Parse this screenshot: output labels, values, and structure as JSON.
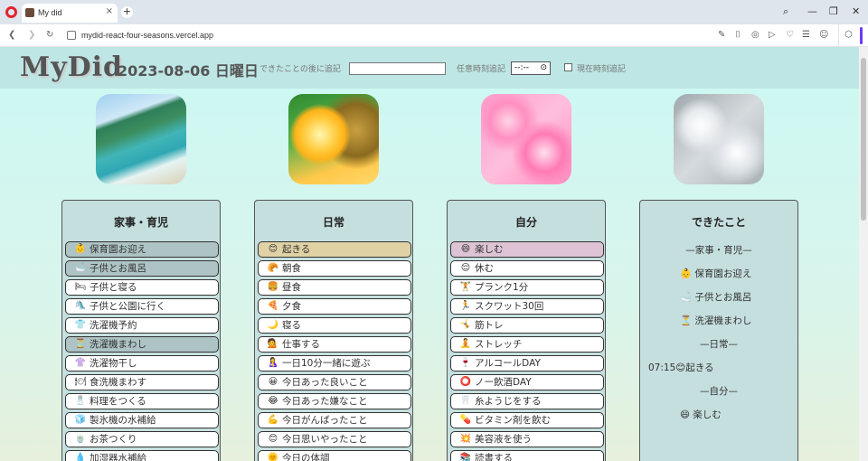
{
  "browser": {
    "tab_title": "My did",
    "tab_close": "×",
    "new_tab": "+",
    "url": "mydid-react-four-seasons.vercel.app",
    "icons": [
      "back-icon",
      "forward-icon",
      "reload-icon",
      "home-icon",
      "site-info-icon",
      "snapshot-icon",
      "camera-icon",
      "vpn-icon",
      "play-icon",
      "heart-icon",
      "menu-icon",
      "profile-icon",
      "extensions-icon"
    ]
  },
  "header": {
    "logo": "MyDid",
    "date": "2023-08-06 日曜日",
    "after_label": "できたことの後に追記",
    "after_value": "",
    "time_label": "任意時刻追記",
    "time_value": "--:--",
    "now_label": "現在時刻追記"
  },
  "columns": [
    {
      "title": "家事・育児",
      "image": "beach-image",
      "items": [
        {
          "icon": "👶",
          "label": "保育園お迎え",
          "state": "sel"
        },
        {
          "icon": "🛁",
          "label": "子供とお風呂",
          "state": "sel"
        },
        {
          "icon": "🛏",
          "label": "子供と寝る",
          "state": ""
        },
        {
          "icon": "🛝",
          "label": "子供と公園に行く",
          "state": ""
        },
        {
          "icon": "👕",
          "label": "洗濯機予約",
          "state": ""
        },
        {
          "icon": "⏳",
          "label": "洗濯機まわし",
          "state": "sel"
        },
        {
          "icon": "👚",
          "label": "洗濯物干し",
          "state": ""
        },
        {
          "icon": "🍽",
          "label": "食洗機まわす",
          "state": ""
        },
        {
          "icon": "🧂",
          "label": "料理をつくる",
          "state": ""
        },
        {
          "icon": "🧊",
          "label": "製氷機の水補給",
          "state": ""
        },
        {
          "icon": "🍵",
          "label": "お茶つくり",
          "state": ""
        },
        {
          "icon": "💧",
          "label": "加湿器水補給",
          "state": ""
        }
      ]
    },
    {
      "title": "日常",
      "image": "pineapple-juice-image",
      "items": [
        {
          "icon": "😊",
          "label": "起きる",
          "state": "sel-daily"
        },
        {
          "icon": "🥐",
          "label": "朝食",
          "state": ""
        },
        {
          "icon": "🍔",
          "label": "昼食",
          "state": ""
        },
        {
          "icon": "🍕",
          "label": "夕食",
          "state": ""
        },
        {
          "icon": "🌙",
          "label": "寝る",
          "state": ""
        },
        {
          "icon": "💁",
          "label": "仕事する",
          "state": ""
        },
        {
          "icon": "🤱",
          "label": "一日10分一緒に遊ぶ",
          "state": ""
        },
        {
          "icon": "😀",
          "label": "今日あった良いこと",
          "state": ""
        },
        {
          "icon": "😂",
          "label": "今日あった嫌なこと",
          "state": ""
        },
        {
          "icon": "💪",
          "label": "今日がんばったこと",
          "state": ""
        },
        {
          "icon": "😊",
          "label": "今日思いやったこと",
          "state": ""
        },
        {
          "icon": "🌞",
          "label": "今日の体調",
          "state": ""
        }
      ]
    },
    {
      "title": "自分",
      "image": "pink-flowers-image",
      "items": [
        {
          "icon": "😄",
          "label": "楽しむ",
          "state": "sel-self"
        },
        {
          "icon": "😌",
          "label": "休む",
          "state": ""
        },
        {
          "icon": "🏋",
          "label": "プランク1分",
          "state": ""
        },
        {
          "icon": "🏃",
          "label": "スクワット30回",
          "state": ""
        },
        {
          "icon": "🤸",
          "label": "筋トレ",
          "state": ""
        },
        {
          "icon": "🧘",
          "label": "ストレッチ",
          "state": ""
        },
        {
          "icon": "🍷",
          "label": "アルコールDAY",
          "state": ""
        },
        {
          "icon": "⭕",
          "label": "ノー飲酒DAY",
          "state": ""
        },
        {
          "icon": "🦷",
          "label": "糸ようじをする",
          "state": ""
        },
        {
          "icon": "💊",
          "label": "ビタミン剤を飲む",
          "state": ""
        },
        {
          "icon": "💥",
          "label": "美容液を使う",
          "state": ""
        },
        {
          "icon": "📚",
          "label": "読書する",
          "state": ""
        }
      ]
    }
  ],
  "done": {
    "title": "できたこと",
    "image": "white-flowers-image",
    "lines": [
      {
        "text": "—家事・育児—",
        "kind": "section"
      },
      {
        "text": "👶 保育園お迎え",
        "kind": "entry"
      },
      {
        "text": "🛁 子供とお風呂",
        "kind": "entry"
      },
      {
        "text": "⏳ 洗濯機まわし",
        "kind": "entry"
      },
      {
        "text": "—日常—",
        "kind": "section"
      },
      {
        "text": "07:15😊起きる",
        "kind": "timed"
      },
      {
        "text": "—自分—",
        "kind": "section"
      },
      {
        "text": "😄 楽しむ",
        "kind": "entry"
      }
    ]
  }
}
